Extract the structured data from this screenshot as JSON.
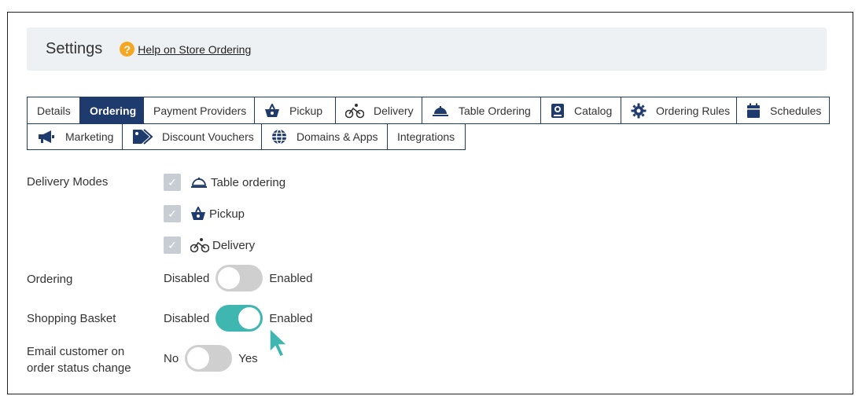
{
  "header": {
    "title": "Settings",
    "help_link": "Help on Store Ordering"
  },
  "tabs": {
    "row1": [
      {
        "label": "Details",
        "icon": ""
      },
      {
        "label": "Ordering",
        "icon": "",
        "active": true
      },
      {
        "label": "Payment Providers",
        "icon": ""
      },
      {
        "label": "Pickup",
        "icon": "basket-icon"
      },
      {
        "label": "Delivery",
        "icon": "bicycle-icon"
      },
      {
        "label": "Table Ordering",
        "icon": "cloche-icon"
      },
      {
        "label": "Catalog",
        "icon": "catalog-icon"
      },
      {
        "label": "Ordering Rules",
        "icon": "gear-icon"
      },
      {
        "label": "Schedules",
        "icon": "calendar-icon"
      }
    ],
    "row2": [
      {
        "label": "Marketing",
        "icon": "megaphone-icon"
      },
      {
        "label": "Discount Vouchers",
        "icon": "tags-icon"
      },
      {
        "label": "Domains & Apps",
        "icon": "globe-icon"
      },
      {
        "label": "Integrations",
        "icon": ""
      }
    ]
  },
  "form": {
    "delivery_modes": {
      "label": "Delivery Modes",
      "options": [
        {
          "label": "Table ordering",
          "checked": true
        },
        {
          "label": "Pickup",
          "checked": true
        },
        {
          "label": "Delivery",
          "checked": true
        }
      ]
    },
    "ordering": {
      "label": "Ordering",
      "off_label": "Disabled",
      "on_label": "Enabled",
      "value": false
    },
    "shopping_basket": {
      "label": "Shopping Basket",
      "off_label": "Disabled",
      "on_label": "Enabled",
      "value": true
    },
    "email_customer": {
      "label_line1": "Email customer on",
      "label_line2": "order status change",
      "off_label": "No",
      "on_label": "Yes",
      "value": false
    }
  },
  "colors": {
    "accent": "#1f3a6d",
    "toggle_on": "#3fb7b0",
    "cursor": "#3fb7b0",
    "help_icon": "#f5a623"
  }
}
